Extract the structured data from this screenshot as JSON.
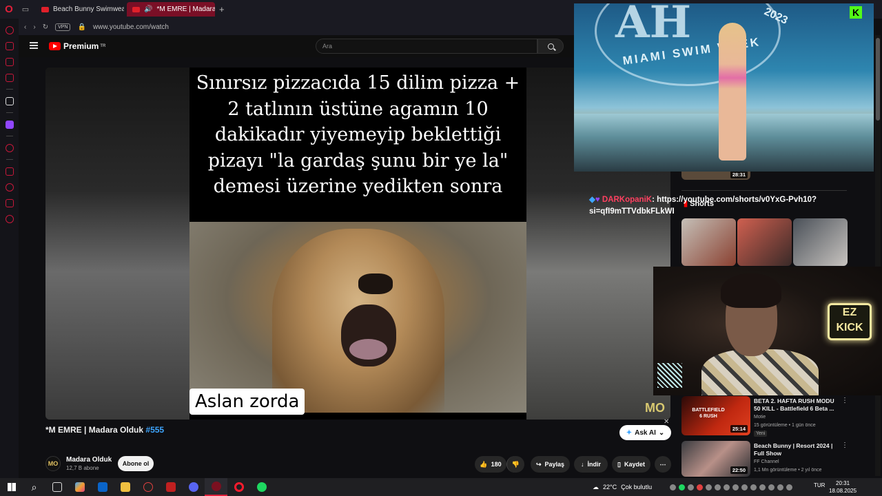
{
  "browser": {
    "tabs": [
      {
        "title": "Beach Bunny Swimwear R"
      },
      {
        "title": "*M EMRE | Madara Ol"
      }
    ],
    "new_tab": "+",
    "vpn_label": "VPN",
    "url": "www.youtube.com/watch"
  },
  "youtube": {
    "brand": "Premium",
    "brand_region": "TR",
    "search_placeholder": "Ara",
    "video": {
      "caption": "Sınırsız pizzacıda 15 dilim pizza + 2 tatlının üstüne agamın 10 dakikadır yiyemeyip beklettiği pizayı \"la gardaş şunu bir ye la\" demesi üzerine yedikten sonra",
      "overlay_label": "Aslan zorda",
      "watermark": "MO"
    },
    "title_main": "*M EMRE | Madara Olduk ",
    "title_tag": "#555",
    "ask_ai": "Ask AI",
    "channel": {
      "avatar": "MO",
      "name": "Madara Olduk",
      "subs": "12,7 B abone",
      "subscribe": "Abone ol"
    },
    "actions": {
      "likes": "180",
      "share": "Paylaş",
      "download": "İndir",
      "save": "Kaydet"
    },
    "shorts_label": "Shorts",
    "shorts_duration": "28:31",
    "recommendations": [
      {
        "title": "BETA 2. HAFTA RUSH MODU 50 KILL - Battlefield 6 Beta ...",
        "channel": "Motie",
        "meta": "15 görüntüleme • 1 gün önce",
        "badge": "Yeni",
        "duration": "25:14",
        "thumb_text": "BATTLEFIELD 6 RUSH"
      },
      {
        "title": "Beach Bunny | Resort 2024 | Full Show",
        "channel": "FF Channel",
        "meta": "1,1 Mn görüntüleme • 2 yıl önce",
        "duration": "22:50"
      }
    ]
  },
  "chat": {
    "username": "DARKopaniK",
    "message": ": https://youtube.com/shorts/v0YxG-Pvh10?si=qfI9mTTVdbkFLkWI"
  },
  "overlays": {
    "pip_logo": "AH",
    "pip_text": "MIAMI SWIM WEEK",
    "pip_year": "2023",
    "kick_k": "K",
    "ez_top": "EZ",
    "ez_bottom": "KICK"
  },
  "taskbar": {
    "temperature": "22°C",
    "weather": "Çok bulutlu",
    "language": "TUR",
    "time": "20:31",
    "date": "18.08.2025"
  },
  "colors": {
    "accent_red": "#ff0000",
    "opera_red": "#e0203a",
    "link_blue": "#3ea6ff",
    "kick_green": "#53fc18"
  }
}
